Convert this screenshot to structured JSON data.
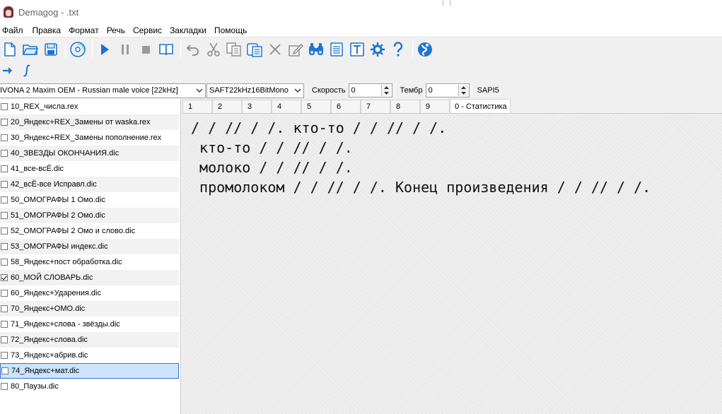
{
  "window": {
    "title": "Demagog - .txt"
  },
  "menu": [
    "Файл",
    "Правка",
    "Формат",
    "Речь",
    "Сервис",
    "Закладки",
    "Помощь"
  ],
  "toolbar": {
    "icons": [
      "new-file-icon",
      "open-folder-icon",
      "save-icon",
      "cd-icon",
      "play-icon",
      "pause-icon",
      "stop-icon",
      "book-icon",
      "undo-icon",
      "cut-icon",
      "copy-icon",
      "paste-icon",
      "delete-icon",
      "edit-icon",
      "find-icon",
      "list-icon",
      "text-icon",
      "settings-icon",
      "help-icon",
      "globe-icon"
    ],
    "row2_icons": [
      "arrow-right-icon",
      "integral-icon"
    ]
  },
  "settings": {
    "voice": "IVONA 2 Maxim OEM - Russian male voice [22kHz]",
    "format": "SAFT22kHz16BitMono",
    "speed_label": "Скорость",
    "speed_value": "0",
    "timbre_label": "Тембр",
    "timbre_value": "0",
    "engine": "SAPI5"
  },
  "dictionaries": [
    {
      "label": "10_REX_числа.rex",
      "checked": false
    },
    {
      "label": "20_Яндекс+REX_Замены от waska.rex",
      "checked": false
    },
    {
      "label": "30_Яндекс+REX_Замены пополнение.rex",
      "checked": false
    },
    {
      "label": "40_ЗВЕЗДЫ ОКОНЧАНИЯ.dic",
      "checked": false
    },
    {
      "label": "41_все-всЁ.dic",
      "checked": false
    },
    {
      "label": "42_всЁ-все Исправл.dic",
      "checked": false
    },
    {
      "label": "50_ОМОГРАФЫ 1 Омо.dic",
      "checked": false
    },
    {
      "label": "51_ОМОГРАФЫ 2 Омо.dic",
      "checked": false
    },
    {
      "label": "52_ОМОГРАФЫ 2 Омо и слово.dic",
      "checked": false
    },
    {
      "label": "53_ОМОГРАФЫ индекс.dic",
      "checked": false
    },
    {
      "label": "58_Яндекс+пост обработка.dic",
      "checked": false
    },
    {
      "label": "60_МОЙ СЛОВАРЬ.dic",
      "checked": true
    },
    {
      "label": "60_Яндекс+Ударения.dic",
      "checked": false
    },
    {
      "label": "70_Яндекс+ОМО.dic",
      "checked": false
    },
    {
      "label": "71_Яндекс+слова - звёзды.dic",
      "checked": false
    },
    {
      "label": "72_Яндекс+слова.dic",
      "checked": false
    },
    {
      "label": "73_Яндекс+абрив.dic",
      "checked": false
    },
    {
      "label": "74_Яндекс+мат.dic",
      "checked": false,
      "selected": true
    },
    {
      "label": "80_Паузы.dic",
      "checked": false
    }
  ],
  "tabs": [
    "1",
    "2",
    "3",
    "4",
    "5",
    "6",
    "7",
    "8",
    "9",
    "0 - Статистика"
  ],
  "active_tab": "0 - Статистика",
  "editor": {
    "lines": [
      "/ / // / /. кто-то / / // / /.",
      " кто-то / / // / /.",
      " молоко / / // / /.",
      " промолоком / / // / /. Конец произведения / / // / /."
    ]
  },
  "colors": {
    "selection": "#cce4ff",
    "selection_border": "#3b6fd6",
    "play": "#1f6fd1",
    "accent": "#1e74d0"
  }
}
